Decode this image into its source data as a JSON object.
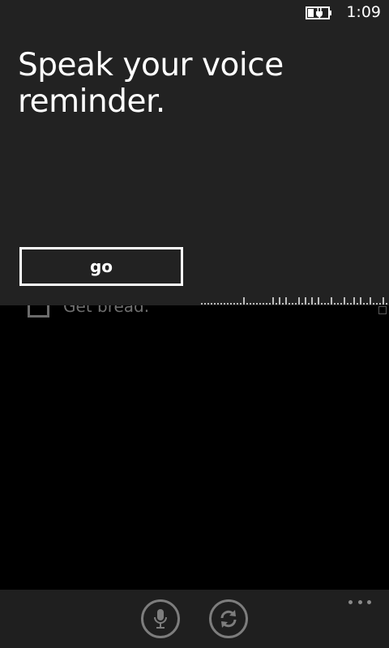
{
  "status_bar": {
    "time": "1:09",
    "battery_icon": "battery-charging-icon"
  },
  "background_list": {
    "items": [
      {
        "label": "Get bread.",
        "checked": false
      }
    ]
  },
  "voice_prompt": {
    "title": "Speak your voice reminder.",
    "go_label": "go"
  },
  "app_bar": {
    "buttons": [
      {
        "icon": "microphone-icon"
      },
      {
        "icon": "sync-icon"
      }
    ],
    "more_icon": "ellipsis-icon"
  },
  "colors": {
    "panel": "#222222",
    "background": "#000000",
    "app_bar": "#1f1f1f",
    "muted_text": "#6f6f6f"
  }
}
